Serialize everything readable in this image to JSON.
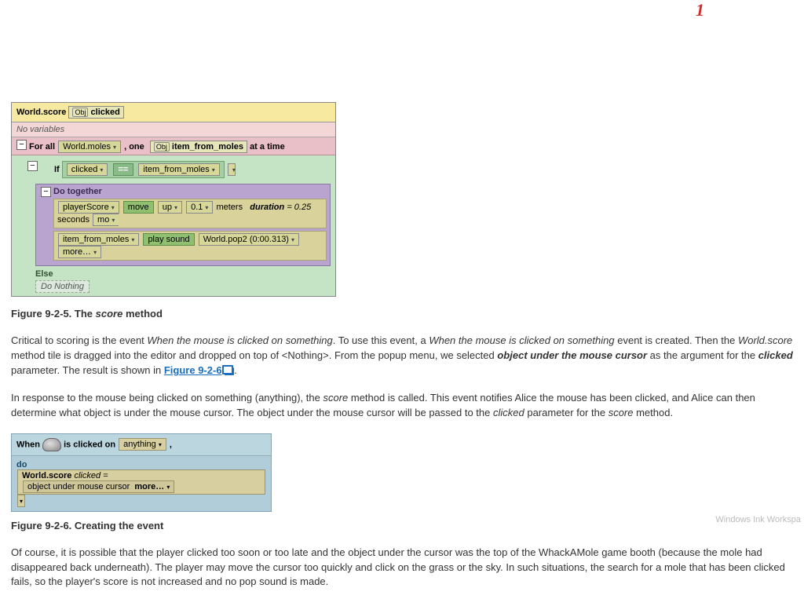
{
  "top_mark": "1",
  "fig1": {
    "header_world": "World.score",
    "obj_chip": "Obj",
    "header_param": "clicked",
    "novars": "No variables",
    "for_all": "For all",
    "world_moles": "World.moles",
    "one": ", one",
    "item_from_moles": "item_from_moles",
    "at_a_time": "at a time",
    "if": "If",
    "clicked": "clicked",
    "eq": "==",
    "do_together": "Do together",
    "player_score": "playerScore",
    "move": "move",
    "up": "up",
    "dist": "0.1",
    "meters": "meters",
    "duration_k": "duration",
    "duration_v": "= 0.25",
    "seconds": "seconds",
    "mo": "mo",
    "play_sound": "play sound",
    "pop2": "World.pop2 (0:00.313)",
    "more": "more…",
    "else": "Else",
    "do_nothing": "Do Nothing"
  },
  "caption1_pre": "Figure 9-2-5. The ",
  "caption1_ital": "score",
  "caption1_post": " method",
  "p1": {
    "t1": "Critical to scoring is the event ",
    "e1": "When the mouse is clicked on something",
    "t2": ". To use this event, a ",
    "e2": "When the mouse is clicked on something",
    "t3": " event is created. Then the ",
    "e3": "World.score",
    "t4": " method tile is dragged into the editor and dropped on top of <Nothing>. From the popup menu, we selected ",
    "e4": "object under the mouse cursor",
    "t5": " as the argument for the ",
    "e5": "clicked",
    "t6": " parameter. The result is shown in ",
    "link": "Figure 9-2-6",
    "t7": "."
  },
  "p2": {
    "t1": "In response to the mouse being clicked on something (anything), the ",
    "e1": "score",
    "t2": " method is called. This event notifies Alice the mouse has been clicked, and Alice can then determine what object is under the mouse cursor. The object under the mouse cursor will be passed to the ",
    "e2": "clicked",
    "t3": " parameter for the ",
    "e3": "score",
    "t4": " method."
  },
  "fig2": {
    "when": "When",
    "is_clicked_on": "is clicked on",
    "anything": "anything",
    "comma": ",",
    "do": "do",
    "world_score": "World.score",
    "clicked_eq": "clicked =",
    "obj_under": "object under mouse cursor",
    "more": "more…"
  },
  "caption2": "Figure 9-2-6. Creating the event",
  "p3": "Of course, it is possible that the player clicked too soon or too late and the object under the cursor was the top of the WhackAMole game booth (because the mole had disappeared back underneath). The player may move the cursor too quickly and click on the grass or the sky. In such situations, the search for a mole that has been clicked fails, so the player's score is not increased and no pop sound is made.",
  "watermark": "Windows Ink Workspa"
}
